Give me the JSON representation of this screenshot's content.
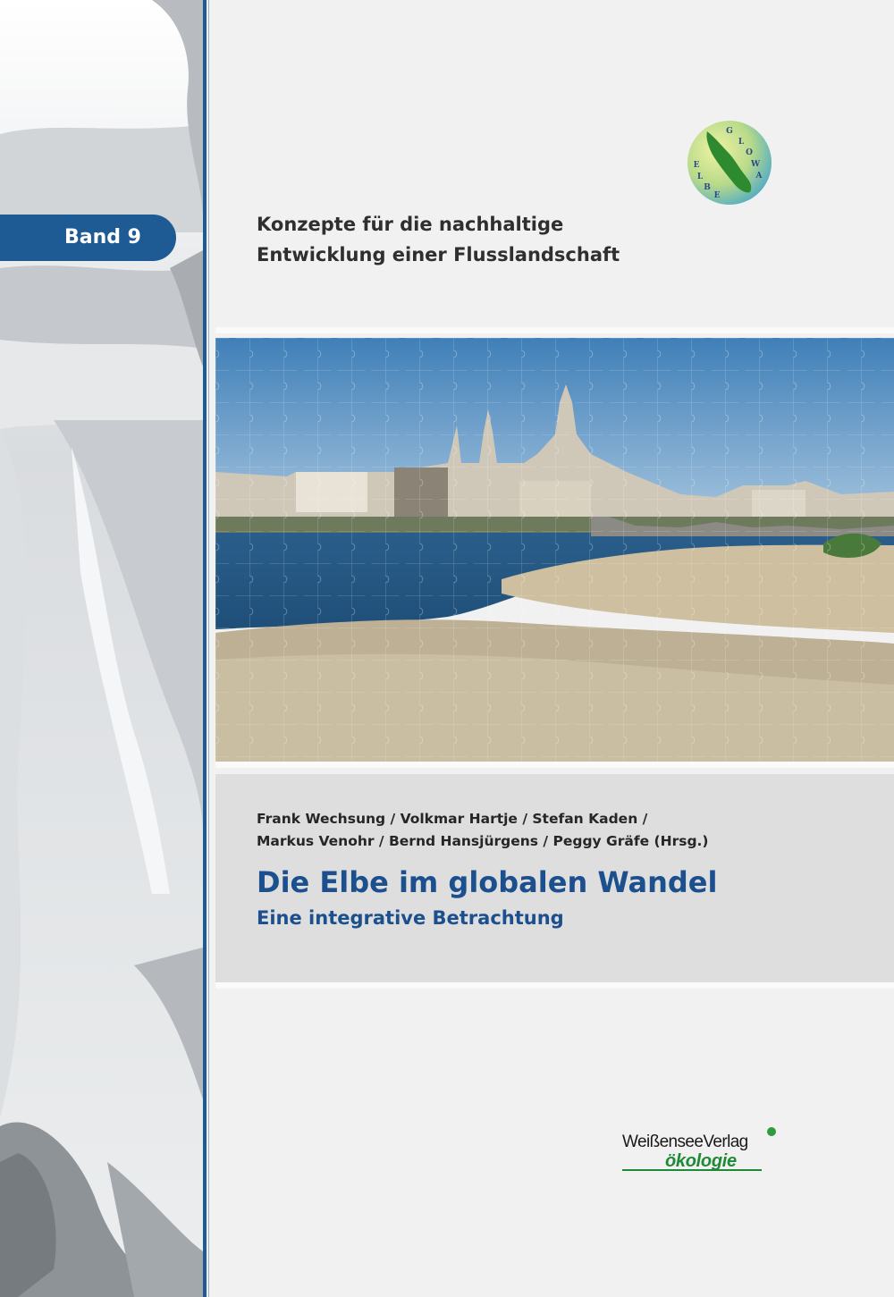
{
  "cover": {
    "band_label": "Band 9",
    "series_title": [
      "Konzepte für die nachhaltige",
      "Entwicklung einer Flusslandschaft"
    ],
    "logo": {
      "name": "glowa-elbe-logo",
      "letters": [
        "G",
        "L",
        "O",
        "W",
        "A",
        "E",
        "L",
        "B",
        "E"
      ]
    },
    "photo": {
      "icon": "dresden-elbe-puzzle-photo"
    },
    "authors": [
      "Frank Wechsung / Volkmar Hartje / Stefan Kaden /",
      "Markus Venohr / Bernd Hansjürgens / Peggy Gräfe (Hrsg.)"
    ],
    "title": "Die Elbe im globalen Wandel",
    "subtitle": "Eine integrative Betrachtung",
    "publisher": {
      "top": "WeißenseeVerlag",
      "bottom": "ökologie"
    }
  },
  "colors": {
    "accent_blue": "#1e5a94",
    "title_blue": "#1c4f8d",
    "panel_grey": "#dedede",
    "publisher_green": "#1f8a35"
  }
}
